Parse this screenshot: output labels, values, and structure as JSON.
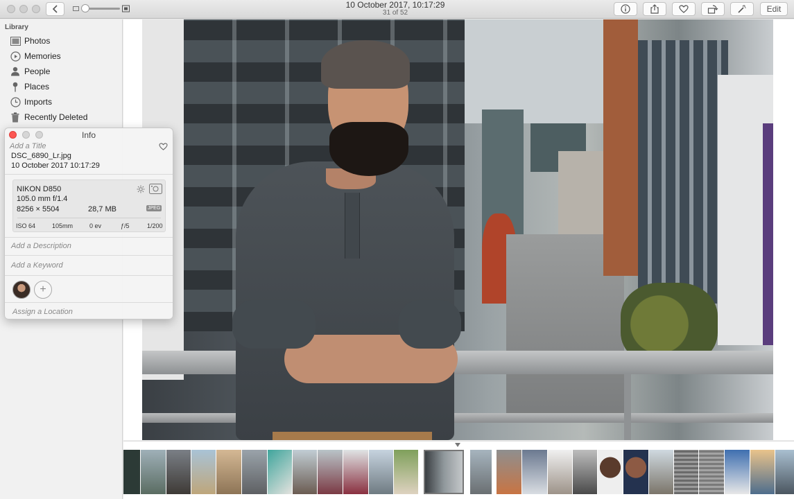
{
  "window": {
    "title": "10 October 2017, 10:17:29",
    "subtitle": "31 of 52"
  },
  "toolbar": {
    "edit_label": "Edit",
    "icons": [
      "back-chevron-icon",
      "zoom-out-icon",
      "zoom-in-icon",
      "info-icon",
      "share-icon",
      "heart-icon",
      "rotate-icon",
      "magic-wand-icon"
    ]
  },
  "sidebar": {
    "heading": "Library",
    "items": [
      {
        "label": "Photos",
        "icon": "photos-icon"
      },
      {
        "label": "Memories",
        "icon": "memories-icon"
      },
      {
        "label": "People",
        "icon": "people-icon"
      },
      {
        "label": "Places",
        "icon": "places-icon"
      },
      {
        "label": "Imports",
        "icon": "imports-icon"
      },
      {
        "label": "Recently Deleted",
        "icon": "trash-icon"
      }
    ]
  },
  "info": {
    "title": "Info",
    "title_placeholder": "Add a Title",
    "filename": "DSC_6890_Lr.jpg",
    "datetime": "10 October 2017   10:17:29",
    "camera": "NIKON D850",
    "lens": "105.0 mm f/1.4",
    "dimensions": "8256 × 5504",
    "filesize": "28,7 MB",
    "format": "JPEG",
    "exif": {
      "iso": "ISO 64",
      "focal": "105mm",
      "ev": "0 ev",
      "aperture": "ƒ/5",
      "shutter": "1/200"
    },
    "description_placeholder": "Add a Description",
    "keyword_placeholder": "Add a Keyword",
    "location_placeholder": "Assign a Location"
  },
  "colors": {
    "close": "#fc5753",
    "accent": "#0a84ff"
  }
}
